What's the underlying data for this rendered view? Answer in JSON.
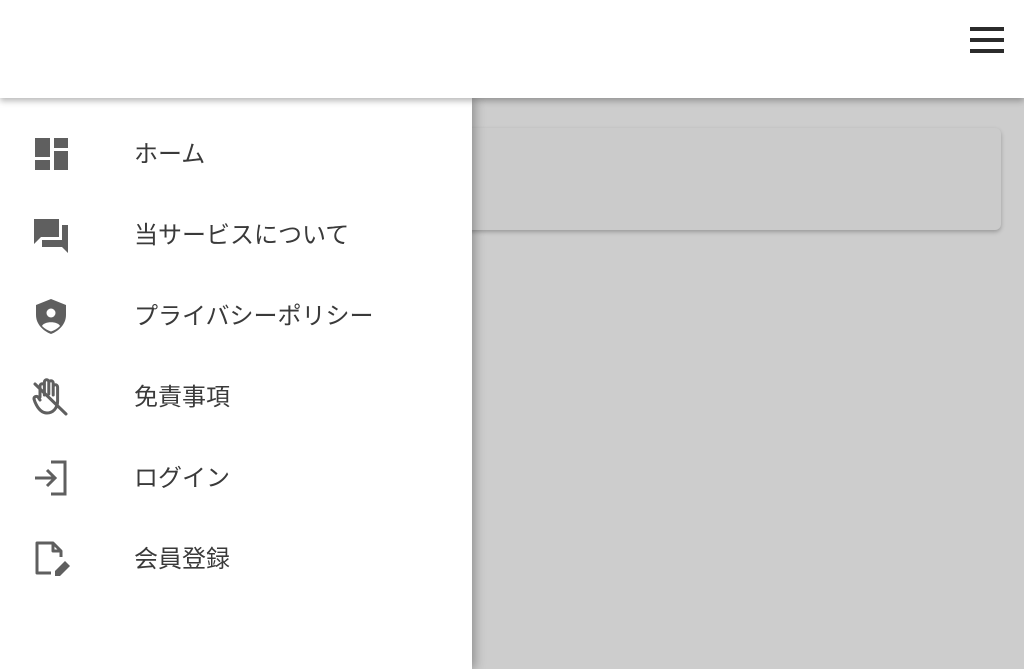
{
  "appbar": {
    "menu_icon": "hamburger-menu-icon"
  },
  "drawer": {
    "items": [
      {
        "label": "ホーム",
        "icon": "dashboard-icon"
      },
      {
        "label": "当サービスについて",
        "icon": "forum-icon"
      },
      {
        "label": "プライバシーポリシー",
        "icon": "shield-person-icon"
      },
      {
        "label": "免責事項",
        "icon": "do-not-touch-icon"
      },
      {
        "label": "ログイン",
        "icon": "login-icon"
      },
      {
        "label": "会員登録",
        "icon": "edit-document-icon"
      }
    ]
  },
  "colors": {
    "overlay": "#cdcdcd",
    "drawer_bg": "#ffffff",
    "text": "#3a3a3a",
    "icon": "#5f5f5f"
  }
}
